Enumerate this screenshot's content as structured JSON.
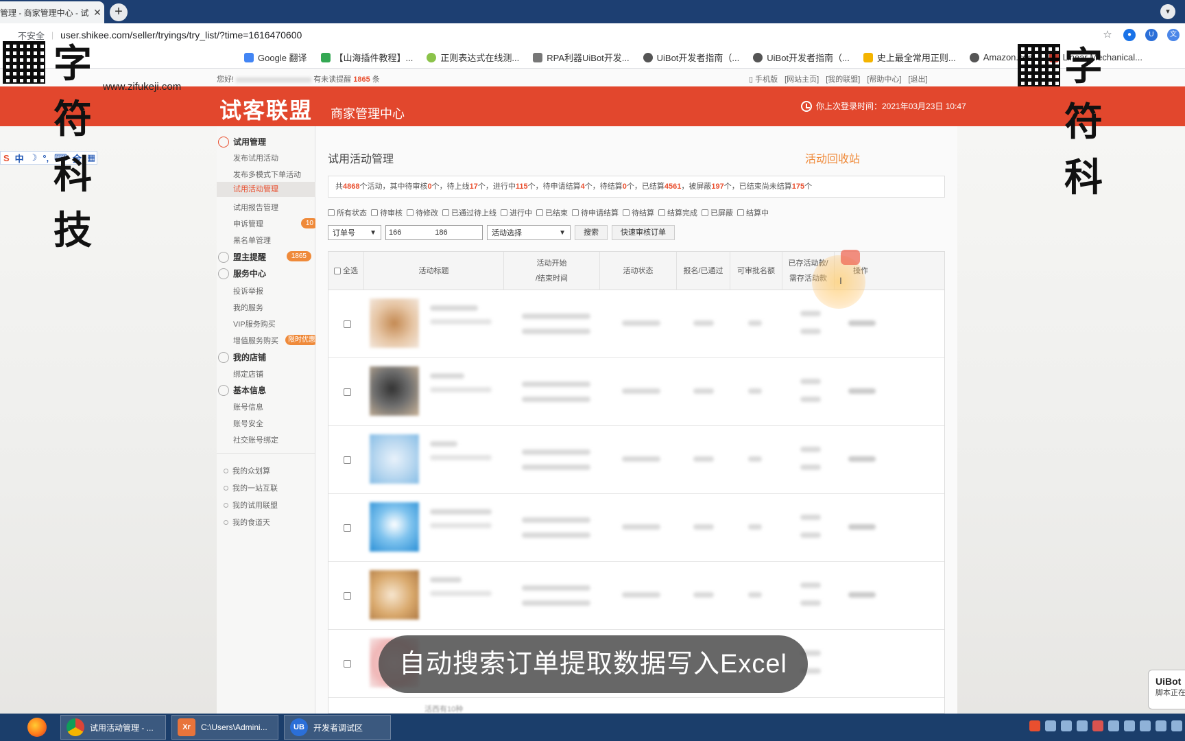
{
  "browser": {
    "tab_title": "管理 - 商家管理中心 - 试",
    "tab_close": "✕",
    "new_tab": "+",
    "security": "不安全",
    "url": "user.shikee.com/seller/tryings/try_list/?time=1616470600",
    "bookmarks": [
      "Google 翻译",
      "【山海插件教程】...",
      "正则表达式在线测...",
      "RPA利器UiBot开发...",
      "UiBot开发者指南（...",
      "UiBot开发者指南（...",
      "史上最全常用正则...",
      "Amazon.com",
      "Linear Mechanical..."
    ]
  },
  "watermark": {
    "text": "字符科技",
    "url": "www.zifukeji.com",
    "text_right": "字符科"
  },
  "site": {
    "greeting_prefix": "您好!",
    "greeting_unread": "有未读提醒",
    "unread_count": "1865",
    "greeting_suffix": "条",
    "top_links": [
      "手机版",
      "[网站主页]",
      "[我的联盟]",
      "[帮助中心]",
      "[退出]"
    ],
    "logo": "试客联盟",
    "logo_sub": "商家管理中心",
    "last_login": "你上次登录时间：2021年03月23日 10:47"
  },
  "ime": [
    "中",
    "☽",
    "°,",
    "⌨",
    "全",
    "▦"
  ],
  "sidebar": {
    "group_trial": "试用管理",
    "items_trial": [
      "发布试用活动",
      "发布多模式下单活动",
      "试用活动管理",
      "试用报告管理",
      "申诉管理",
      "黑名单管理"
    ],
    "complaint_badge": "10",
    "group_reminder": "盟主提醒",
    "reminder_badge": "1865",
    "group_service": "服务中心",
    "items_service": [
      "投诉举报",
      "我的服务",
      "VIP服务购买",
      "增值服务购买"
    ],
    "value_badge": "限时优惠",
    "group_shop": "我的店铺",
    "items_shop": [
      "绑定店铺"
    ],
    "group_info": "基本信息",
    "items_info": [
      "账号信息",
      "账号安全",
      "社交账号绑定"
    ],
    "extra_links": [
      "我的众划算",
      "我的一站互联",
      "我的试用联盟",
      "我的食道天"
    ]
  },
  "main": {
    "title": "试用活动管理",
    "recycle": "活动回收站",
    "summary": {
      "p1": "共",
      "total": "4868",
      "p2": "个活动，其中待审核",
      "pending": "0",
      "p3": "个，待上线",
      "online": "17",
      "p4": "个，进行中",
      "running": "115",
      "p5": "个，待申请结算",
      "apply": "4",
      "p6": "个，待结算",
      "settle": "0",
      "p7": "个，已结算",
      "settled": "4561",
      "p8": "，被屏蔽",
      "blocked": "197",
      "p9": "个，已结束尚未结算",
      "unsettled": "175",
      "p10": "个"
    },
    "filters": [
      "所有状态",
      "待审核",
      "待修改",
      "已通过待上线",
      "进行中",
      "已结束",
      "待申请结算",
      "待结算",
      "结算完成",
      "已屏蔽",
      "结算中"
    ],
    "search_type": "订单号",
    "search_value": "166                186",
    "activity_select": "活动选择",
    "search_button": "搜索",
    "quick_button": "快速审核订单",
    "columns": {
      "select_all": "全选",
      "title": "活动标题",
      "time_1": "活动开始",
      "time_2": "/结束时间",
      "status": "活动状态",
      "signup": "报名/已通过",
      "approvable": "可审批名额",
      "deposit_1": "已存活动款/",
      "deposit_2": "需存活动款",
      "action": "操作"
    },
    "bottom_text": "活西有10种"
  },
  "caption": "自动搜索订单提取数据写入Excel",
  "uibot": {
    "title": "UiBot",
    "text": "脚本正在"
  },
  "taskbar": {
    "items": [
      "试用活动管理 - ...",
      "C:\\Users\\Admini...",
      "开发者调试区"
    ],
    "icon_labels": [
      "",
      "Xr",
      "UB"
    ]
  },
  "colors": {
    "header": "#e2472d",
    "accent": "#e94f2f",
    "orange": "#ef8a3a"
  }
}
